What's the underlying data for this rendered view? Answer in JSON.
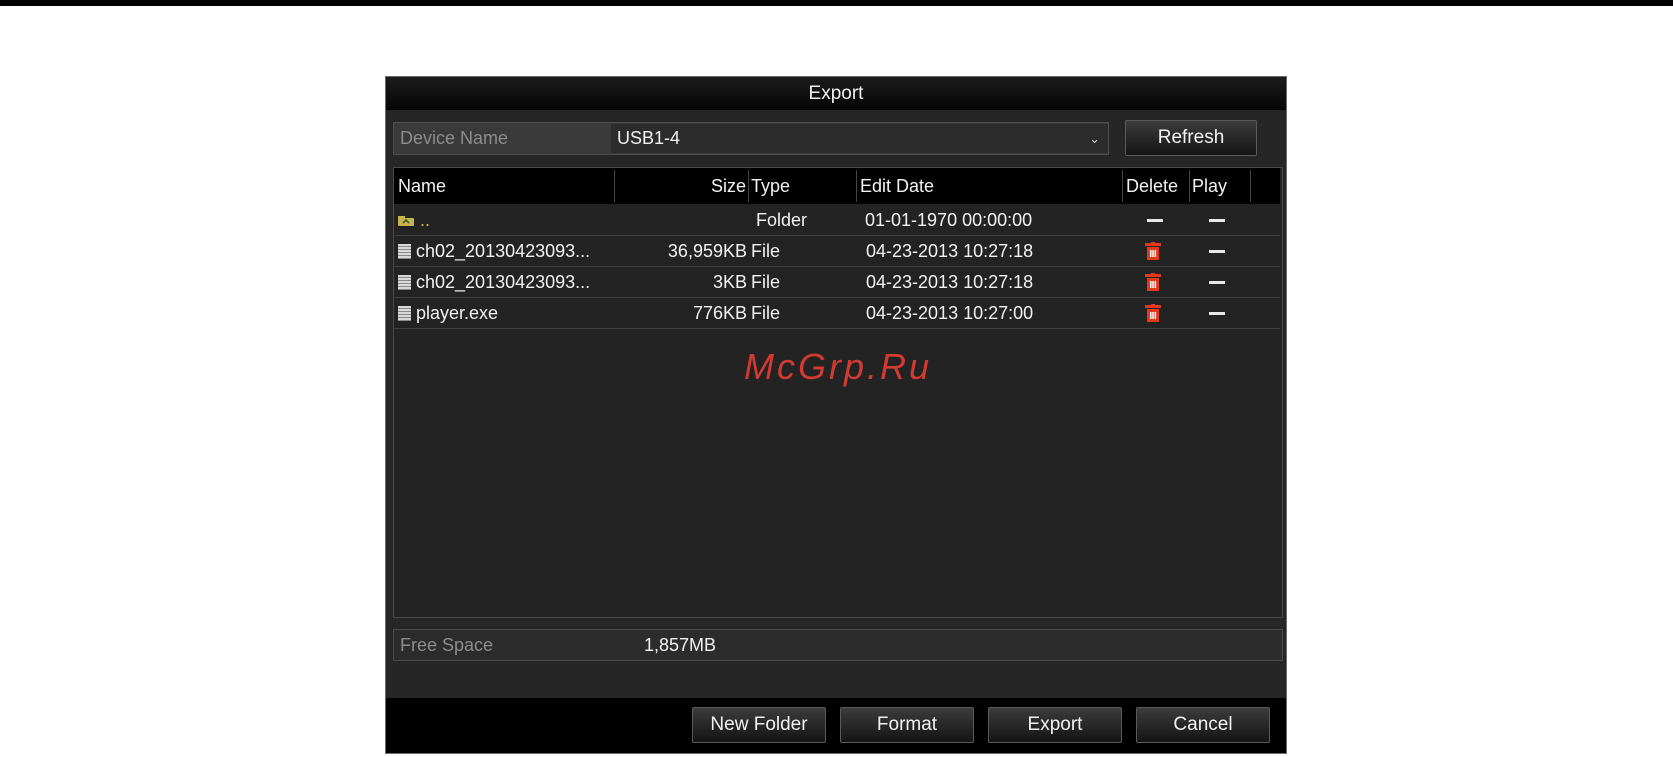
{
  "dialog": {
    "title": "Export"
  },
  "device": {
    "label": "Device Name",
    "value": "USB1-4",
    "refresh_label": "Refresh"
  },
  "table": {
    "headers": {
      "name": "Name",
      "size": "Size",
      "type": "Type",
      "edit_date": "Edit Date",
      "delete": "Delete",
      "play": "Play"
    },
    "rows": [
      {
        "name": "..",
        "size": "",
        "type": "Folder",
        "edit_date": "01-01-1970 00:00:00",
        "icon": "folder-up-icon",
        "delete": "none",
        "play": "none"
      },
      {
        "name": "ch02_20130423093...",
        "size": "36,959KB",
        "type": "File",
        "edit_date": "04-23-2013 10:27:18",
        "icon": "file-icon",
        "delete": "trash-icon",
        "play": "none"
      },
      {
        "name": "ch02_20130423093...",
        "size": "3KB",
        "type": "File",
        "edit_date": "04-23-2013 10:27:18",
        "icon": "file-icon",
        "delete": "trash-icon",
        "play": "none"
      },
      {
        "name": "player.exe",
        "size": "776KB",
        "type": "File",
        "edit_date": "04-23-2013 10:27:00",
        "icon": "file-icon",
        "delete": "trash-icon",
        "play": "none"
      }
    ]
  },
  "free_space": {
    "label": "Free Space",
    "value": "1,857MB"
  },
  "buttons": {
    "new_folder": "New Folder",
    "format": "Format",
    "export": "Export",
    "cancel": "Cancel"
  },
  "watermark": "McGrp.Ru",
  "colors": {
    "delete_icon": "#e0391c",
    "folder_icon": "#c8b54a",
    "dialog_bg": "#262626"
  }
}
